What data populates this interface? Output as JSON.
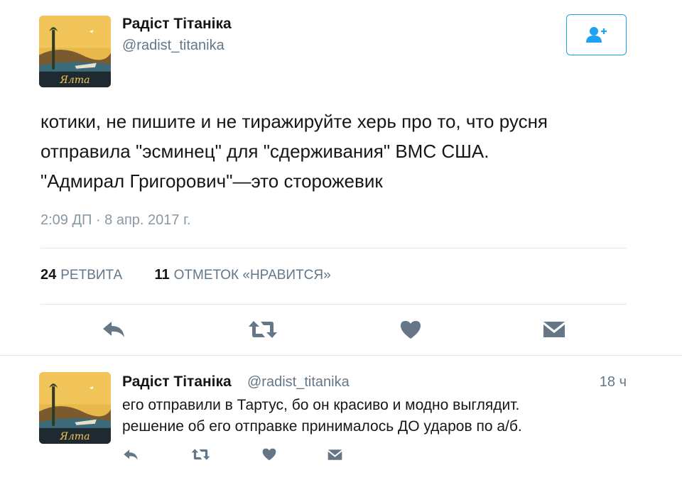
{
  "tweet": {
    "author": {
      "name": "Радіст Тітаніка",
      "handle": "@radist_titanika",
      "avatar_text": "Ялта"
    },
    "follow_button_icon": "add-user-icon",
    "text_lines": [
      "котики, не пишите и не тиражируйте херь про то, что русня",
      "отправила \"эсминец\" для \"сдерживания\" ВМС США.",
      "\"Адмирал Григорович\"—это сторожевик"
    ],
    "timestamp": "2:09 ДП · 8 апр. 2017 г.",
    "stats": {
      "retweets_count": "24",
      "retweets_label": "РЕТВИТА",
      "likes_count": "11",
      "likes_label": "ОТМЕТОК «НРАВИТСЯ»"
    },
    "actions": [
      "reply-icon",
      "retweet-icon",
      "like-icon",
      "message-icon"
    ]
  },
  "reply": {
    "author": {
      "name": "Радіст Тітаніка",
      "handle": "@radist_titanika",
      "avatar_text": "Ялта"
    },
    "time": "18 ч",
    "text_lines": [
      "его отправили в Тартус, бо он красиво и модно выглядит.",
      "решение об его отправке принималось ДО ударов по а/б."
    ],
    "actions": [
      "reply-icon",
      "retweet-icon",
      "like-icon",
      "message-icon"
    ]
  },
  "colors": {
    "accent": "#1da1f2",
    "icon_gray": "#657786",
    "divider": "#e1e8ed"
  }
}
